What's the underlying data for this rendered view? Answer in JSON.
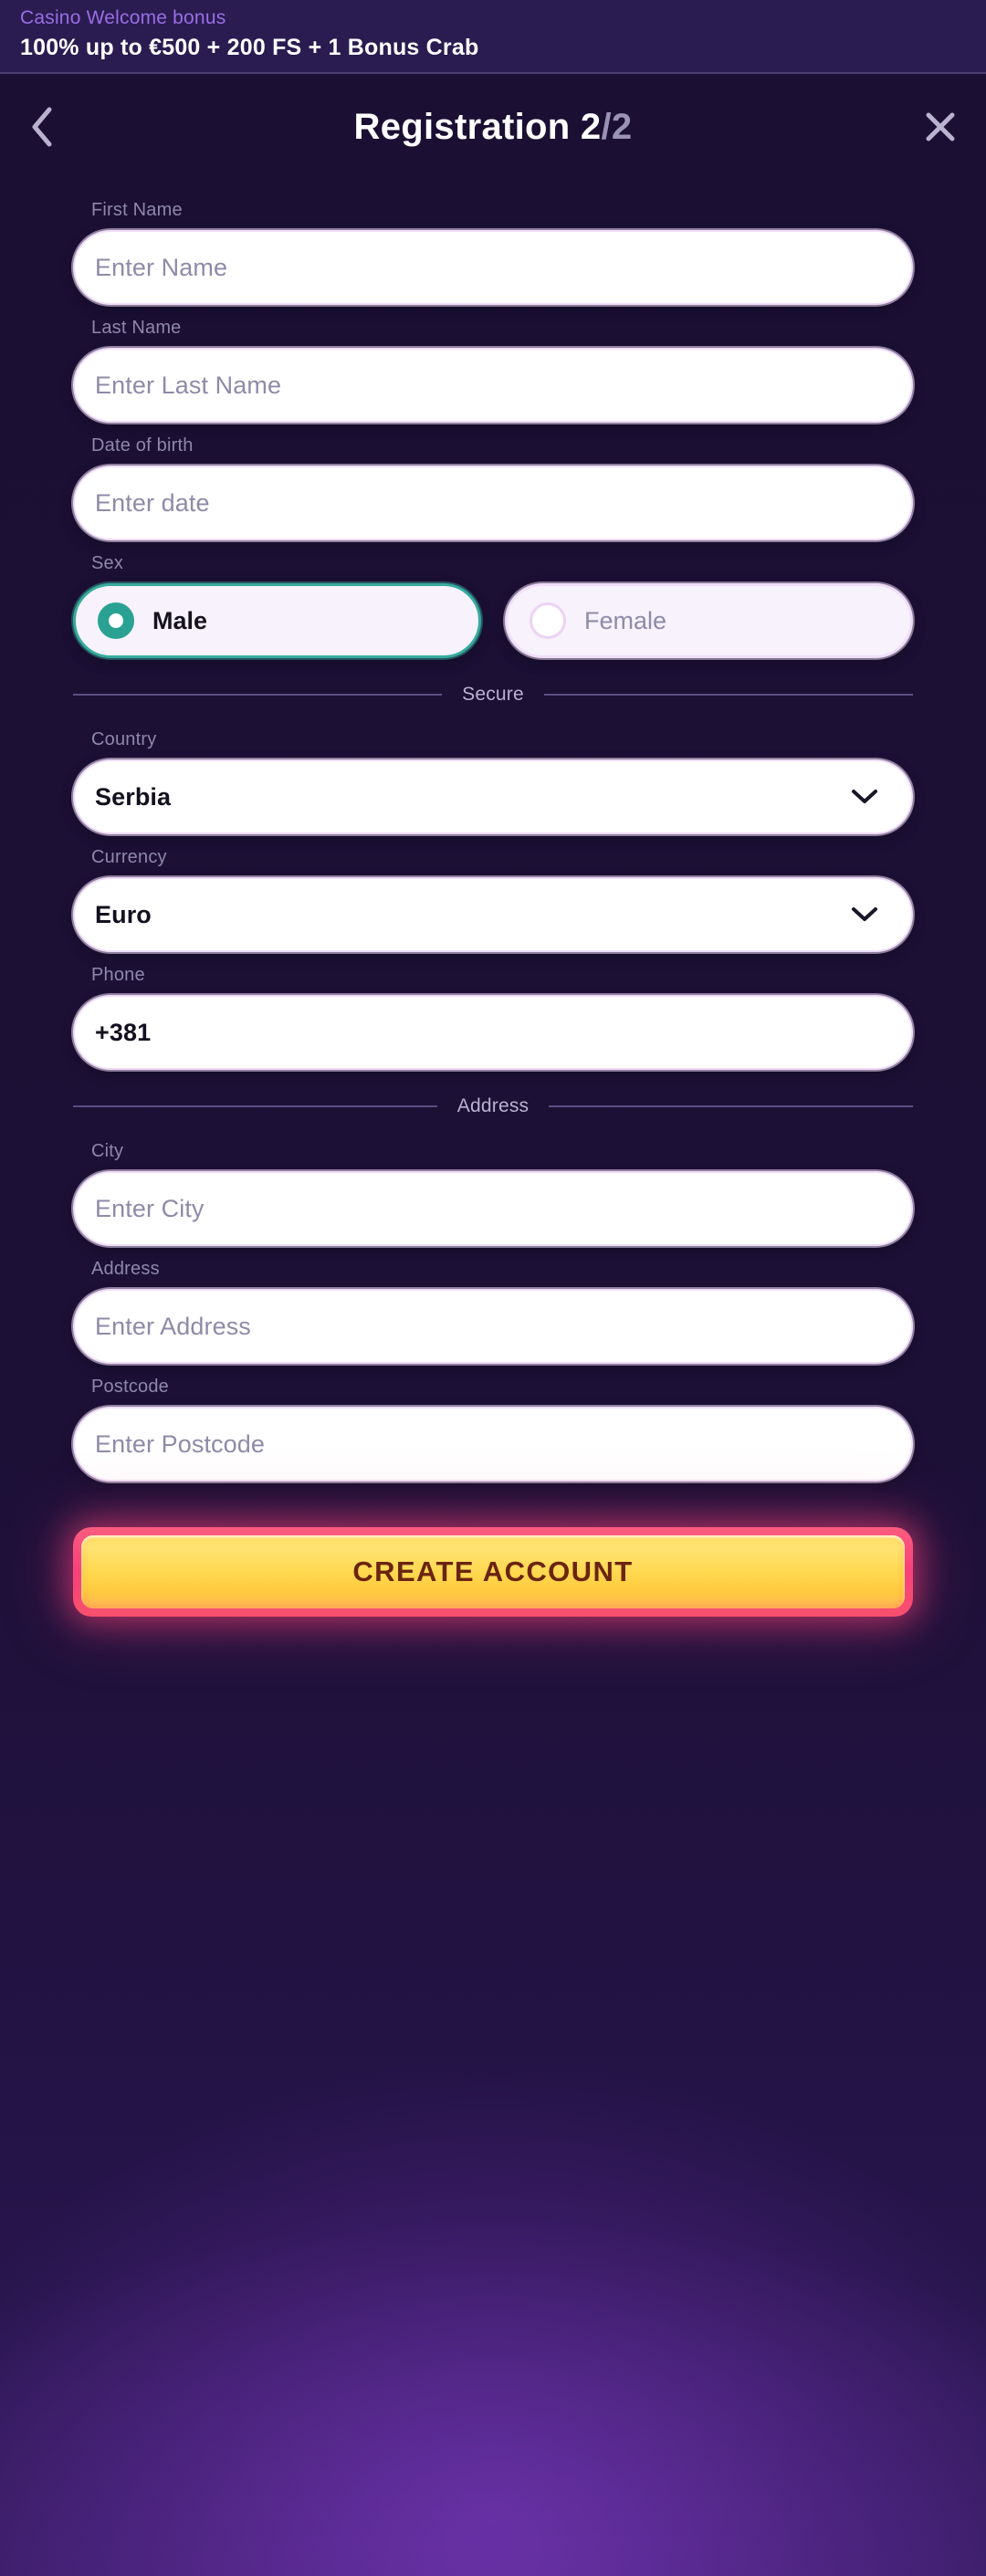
{
  "banner": {
    "subtitle": "Casino Welcome bonus",
    "title": "100% up to €500 + 200 FS + 1 Bonus Crab",
    "subtitle_color": "#9a6de6",
    "background": "#2a1c50"
  },
  "header": {
    "title_text": "Registration ",
    "step_current": "2",
    "step_rest": "/2",
    "back_icon": "chevron-left-icon",
    "close_icon": "close-icon"
  },
  "form": {
    "fields": [
      {
        "label": "First Name",
        "placeholder": "Enter Name",
        "value": "",
        "type": "text"
      },
      {
        "label": "Last Name",
        "placeholder": "Enter Last Name",
        "value": "",
        "type": "text"
      },
      {
        "label": "Date of birth",
        "placeholder": "Enter date",
        "value": "",
        "type": "date"
      }
    ],
    "sex": {
      "label": "Sex",
      "options": [
        {
          "label": "Male",
          "selected": true
        },
        {
          "label": "Female",
          "selected": false
        }
      ],
      "selected_color": "#29a294"
    },
    "secure_divider": "Secure",
    "country": {
      "label": "Country",
      "value": "Serbia",
      "icon": "chevron-down-icon"
    },
    "currency": {
      "label": "Currency",
      "value": "Euro",
      "icon": "chevron-down-icon"
    },
    "phone": {
      "label": "Phone",
      "value": "+381",
      "placeholder": ""
    },
    "address_divider": "Address",
    "city": {
      "label": "City",
      "placeholder": "Enter City",
      "value": ""
    },
    "address": {
      "label": "Address",
      "placeholder": "Enter Address",
      "value": ""
    },
    "postcode": {
      "label": "Postcode",
      "placeholder": "Enter Postcode",
      "value": ""
    }
  },
  "cta": {
    "label": "CREATE ACCOUNT",
    "fill_color": "#ffd84e",
    "border_color": "#f6417a",
    "text_color": "#6b2410"
  }
}
